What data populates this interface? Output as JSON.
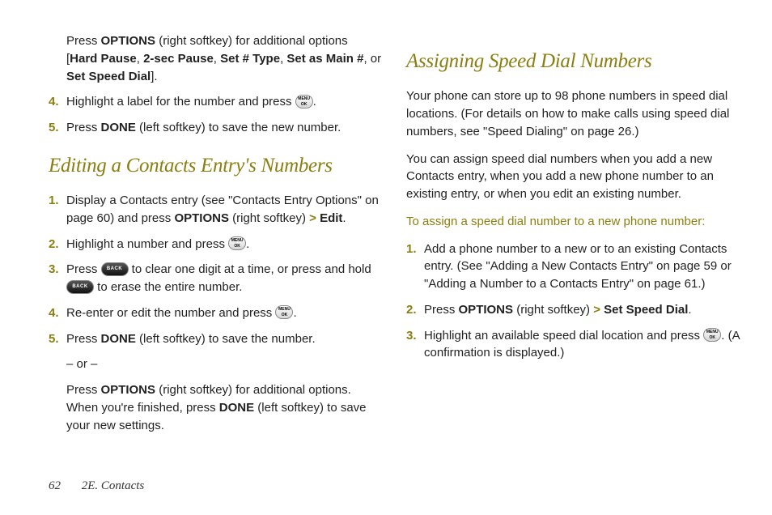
{
  "left": {
    "pre_text1": "Press ",
    "options": "OPTIONS",
    "pre_text2": " (right softkey) for additional options [",
    "opts": [
      "Hard Pause",
      "2-sec Pause",
      "Set # Type",
      "Set as Main #"
    ],
    "pre_or": " or ",
    "opt_last": "Set Speed Dial",
    "pre_close": "].",
    "step4": "Highlight a label for the number and press ",
    "step4_end": ".",
    "step5a": "Press ",
    "done": "DONE",
    "step5b": " (left softkey) to save the new number.",
    "heading": "Editing a Contacts Entry's Numbers",
    "e1a": "Display a Contacts entry (see \"Contacts Entry Options\" on page 60) and press ",
    "e1b": " (right softkey) ",
    "gt": ">",
    "edit": " Edit",
    "period": ".",
    "e2a": "Highlight a number and press ",
    "e3a": "Press ",
    "e3b": " to clear one digit at a time, or press and hold ",
    "e3c": " to erase the entire number.",
    "e4a": "Re-enter or edit the number and press ",
    "e5a": "Press ",
    "e5b": " (left softkey) to save the number.",
    "or": "– or –",
    "e5c1": "Press ",
    "e5c2": " (right softkey) for additional options. When you're finished, press ",
    "e5c3": " (left softkey) to save your new settings."
  },
  "right": {
    "heading": "Assigning Speed Dial Numbers",
    "p1": "Your phone can store up to 98 phone numbers in speed dial locations. (For details on how to make calls using speed dial numbers, see \"Speed Dialing\" on page 26.)",
    "p2": "You can assign speed dial numbers when you add a new Contacts entry, when you add a new phone number to an existing entry, or when you edit an existing number.",
    "sub": "To assign a speed dial number to a new phone number:",
    "s1": "Add a phone number to a new or to an existing Contacts entry. (See \"Adding a New Contacts Entry\" on page 59 or \"Adding a Number to a Contacts Entry\" on page 61.)",
    "s2a": "Press ",
    "options": "OPTIONS",
    "s2b": " (right softkey) ",
    "gt": ">",
    "ssd": " Set Speed Dial",
    "period": ".",
    "s3a": "Highlight an available speed dial location and press ",
    "s3b": ". (A confirmation is displayed.)"
  },
  "key_ok_top": "MENU",
  "key_ok_bot": "OK",
  "key_back": "BACK",
  "footer": {
    "page": "62",
    "section": "2E. Contacts"
  }
}
